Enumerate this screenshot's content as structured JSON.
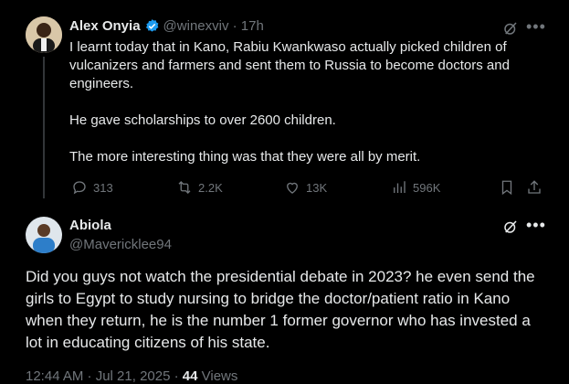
{
  "tweet1": {
    "display_name": "Alex Onyia",
    "handle_time": "@winexviv · 17h",
    "paragraphs": [
      "I learnt today that in Kano, Rabiu Kwankwaso actually picked children of vulcanizers and farmers and sent them to Russia to become doctors and engineers.",
      "He gave scholarships to over 2600 children.",
      "The more interesting thing was that they were all by merit."
    ],
    "replies": "313",
    "reposts": "2.2K",
    "likes": "13K",
    "views": "596K"
  },
  "tweet2": {
    "display_name": "Abiola",
    "handle": "@Mavericklee94",
    "text": "Did you guys not watch the presidential debate in 2023? he even send the girls to Egypt to study nursing to bridge the doctor/patient ratio in Kano when they return, he is the number 1 former governor who has invested a lot in educating citizens of his state.",
    "timestamp": "12:44 AM · Jul 21, 2025 · ",
    "views_count": "44",
    "views_label": " Views"
  },
  "colors": {
    "accent": "#1d9bf0",
    "text": "#e7e9ea",
    "muted": "#71767b",
    "bg": "#000000"
  }
}
